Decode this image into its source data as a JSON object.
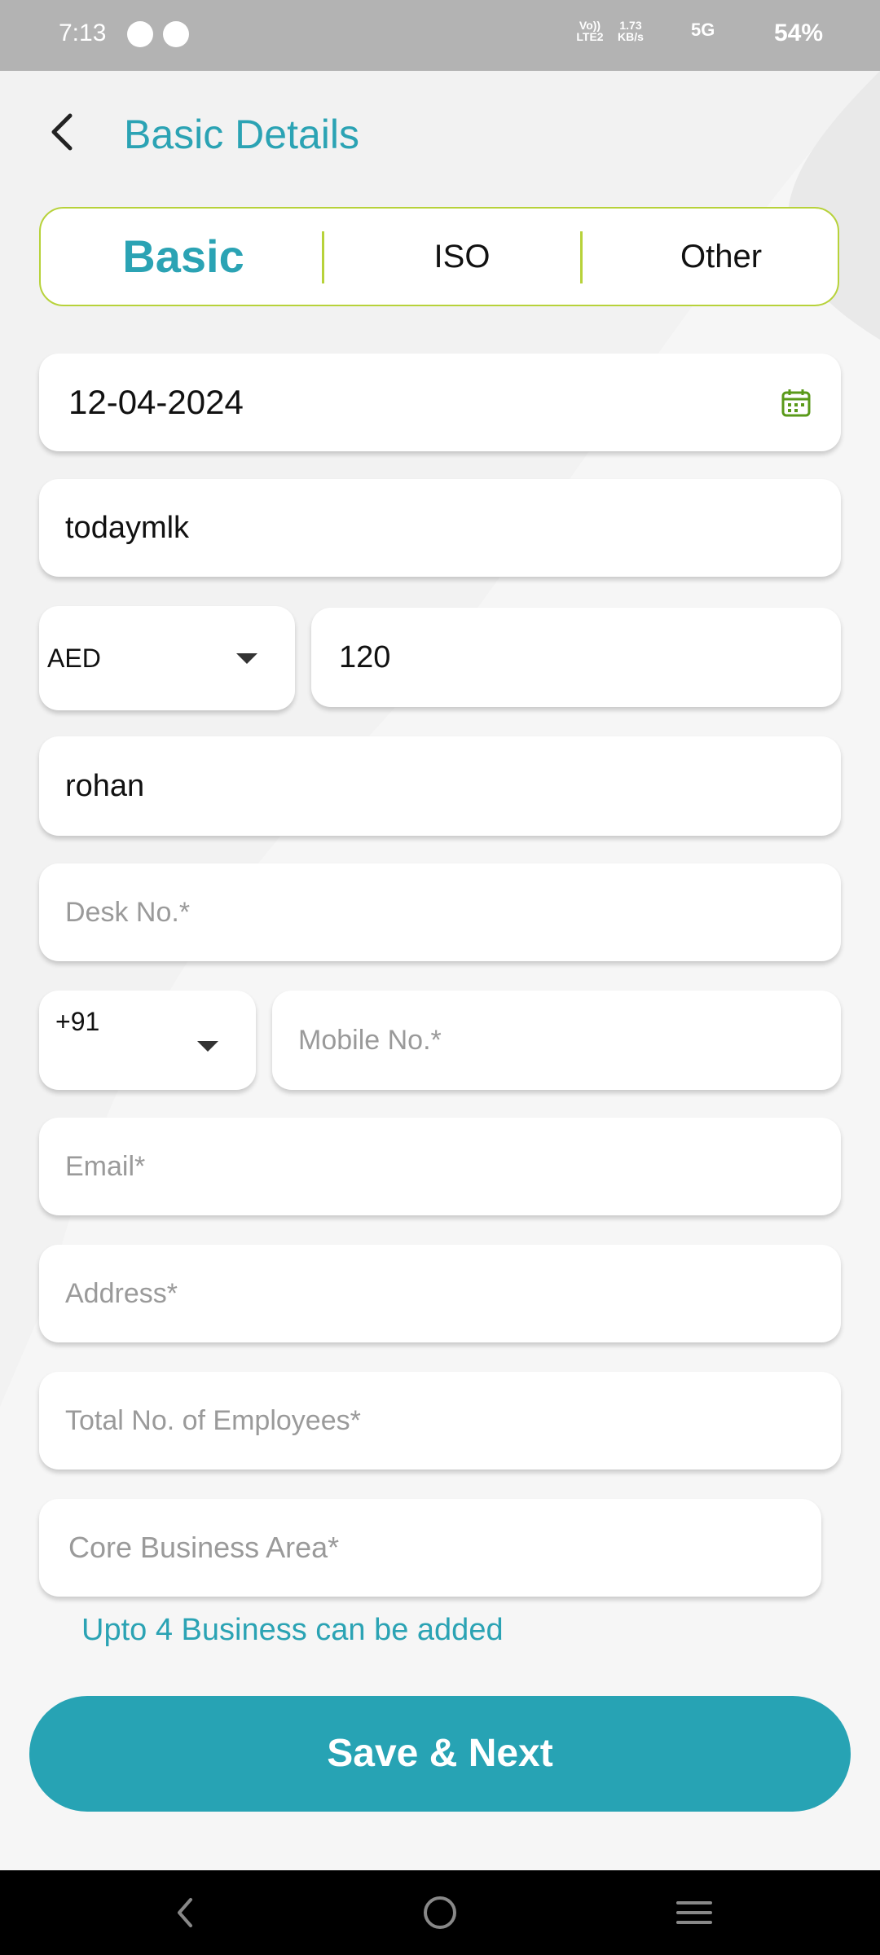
{
  "status_bar": {
    "time": "7:13",
    "volte": "Vo)) LTE2",
    "speed": "1.73 KB/s",
    "network": "5G",
    "battery": "54%"
  },
  "header": {
    "title": "Basic Details"
  },
  "tabs": [
    {
      "label": "Basic",
      "active": true
    },
    {
      "label": "ISO",
      "active": false
    },
    {
      "label": "Other",
      "active": false
    }
  ],
  "form": {
    "date": "12-04-2024",
    "name": "todaymlk",
    "currency": "AED",
    "amount": "120",
    "contact_person": "rohan",
    "desk_no_placeholder": "Desk No.*",
    "country_code": "+91",
    "mobile_placeholder": "Mobile No.*",
    "email_placeholder": "Email*",
    "address_placeholder": "Address*",
    "employees_placeholder": "Total No. of Employees*",
    "business_area_placeholder": "Core Business Area*",
    "business_hint": "Upto 4 Business can be added"
  },
  "actions": {
    "save_next": "Save & Next"
  },
  "colors": {
    "accent": "#2ba3b4",
    "button": "#27a3b4",
    "tab_border": "#b7d23a",
    "calendar_icon": "#5a9a1a"
  },
  "icons": {
    "back": "back-arrow-icon",
    "calendar": "calendar-icon",
    "nav_back": "nav-back-icon",
    "nav_home": "nav-home-icon",
    "nav_recents": "nav-recents-icon"
  }
}
